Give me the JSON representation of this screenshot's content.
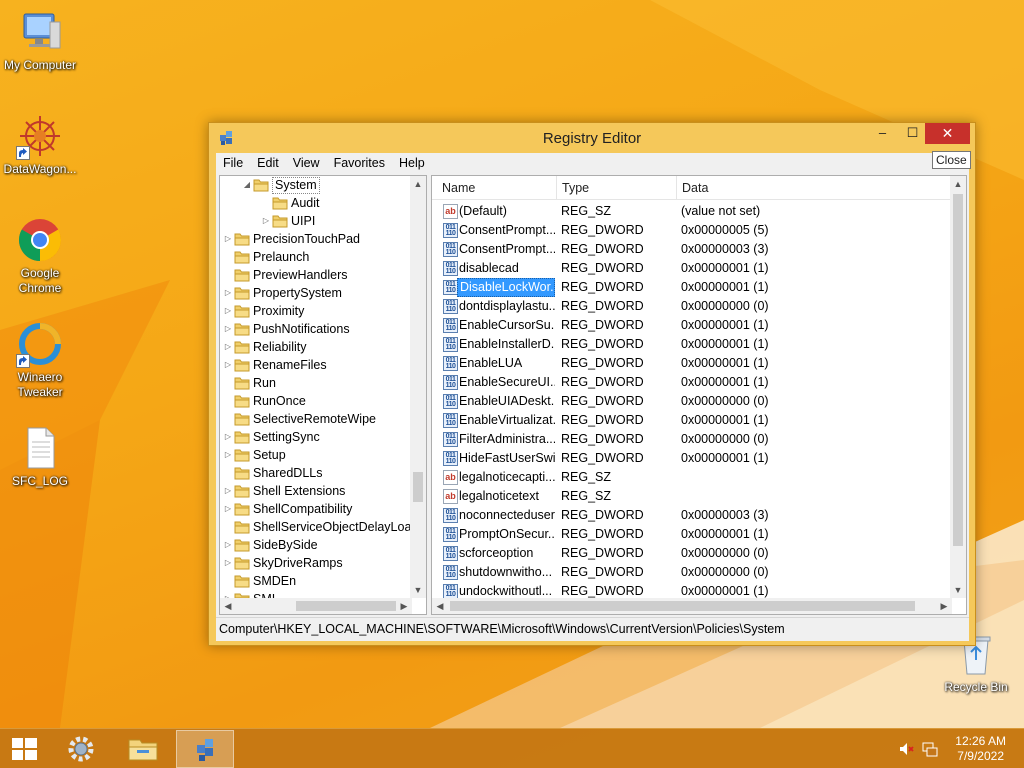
{
  "desktop": {
    "icons": [
      {
        "label": "My Computer",
        "icon": "monitor-icon"
      },
      {
        "label": "DataWagon...",
        "icon": "datawagon-icon"
      },
      {
        "label": "Google Chrome",
        "icon": "chrome-icon"
      },
      {
        "label": "Winaero Tweaker",
        "icon": "winaero-icon"
      },
      {
        "label": "SFC_LOG",
        "icon": "text-file-icon"
      },
      {
        "label": "Recycle Bin",
        "icon": "recycle-bin-icon"
      }
    ]
  },
  "window": {
    "title": "Registry Editor",
    "minimize": "–",
    "maximize": "☐",
    "close": "✕",
    "close_tooltip": "Close",
    "menu": [
      "File",
      "Edit",
      "View",
      "Favorites",
      "Help"
    ],
    "status_path": "Computer\\HKEY_LOCAL_MACHINE\\SOFTWARE\\Microsoft\\Windows\\CurrentVersion\\Policies\\System"
  },
  "tree": {
    "items": [
      {
        "label": "System",
        "expander": "◢",
        "selected": true
      },
      {
        "label": "Audit",
        "expander": ""
      },
      {
        "label": "UIPI",
        "expander": "▷"
      },
      {
        "label": "PrecisionTouchPad",
        "expander": "▷"
      },
      {
        "label": "Prelaunch",
        "expander": ""
      },
      {
        "label": "PreviewHandlers",
        "expander": ""
      },
      {
        "label": "PropertySystem",
        "expander": "▷"
      },
      {
        "label": "Proximity",
        "expander": "▷"
      },
      {
        "label": "PushNotifications",
        "expander": "▷"
      },
      {
        "label": "Reliability",
        "expander": "▷"
      },
      {
        "label": "RenameFiles",
        "expander": "▷"
      },
      {
        "label": "Run",
        "expander": ""
      },
      {
        "label": "RunOnce",
        "expander": ""
      },
      {
        "label": "SelectiveRemoteWipe",
        "expander": ""
      },
      {
        "label": "SettingSync",
        "expander": "▷"
      },
      {
        "label": "Setup",
        "expander": "▷"
      },
      {
        "label": "SharedDLLs",
        "expander": ""
      },
      {
        "label": "Shell Extensions",
        "expander": "▷"
      },
      {
        "label": "ShellCompatibility",
        "expander": "▷"
      },
      {
        "label": "ShellServiceObjectDelayLoad",
        "expander": ""
      },
      {
        "label": "SideBySide",
        "expander": "▷"
      },
      {
        "label": "SkyDriveRamps",
        "expander": "▷"
      },
      {
        "label": "SMDEn",
        "expander": ""
      },
      {
        "label": "SMI",
        "expander": "▷"
      }
    ]
  },
  "list": {
    "columns": [
      "Name",
      "Type",
      "Data"
    ],
    "rows": [
      {
        "name": "(Default)",
        "type": "REG_SZ",
        "data": "(value not set)",
        "kind": "sz"
      },
      {
        "name": "ConsentPrompt...",
        "type": "REG_DWORD",
        "data": "0x00000005 (5)",
        "kind": "dword"
      },
      {
        "name": "ConsentPrompt...",
        "type": "REG_DWORD",
        "data": "0x00000003 (3)",
        "kind": "dword"
      },
      {
        "name": "disablecad",
        "type": "REG_DWORD",
        "data": "0x00000001 (1)",
        "kind": "dword"
      },
      {
        "name": "DisableLockWor...",
        "type": "REG_DWORD",
        "data": "0x00000001 (1)",
        "kind": "dword",
        "selected": true
      },
      {
        "name": "dontdisplaylastu...",
        "type": "REG_DWORD",
        "data": "0x00000000 (0)",
        "kind": "dword"
      },
      {
        "name": "EnableCursorSu...",
        "type": "REG_DWORD",
        "data": "0x00000001 (1)",
        "kind": "dword"
      },
      {
        "name": "EnableInstallerD...",
        "type": "REG_DWORD",
        "data": "0x00000001 (1)",
        "kind": "dword"
      },
      {
        "name": "EnableLUA",
        "type": "REG_DWORD",
        "data": "0x00000001 (1)",
        "kind": "dword"
      },
      {
        "name": "EnableSecureUI...",
        "type": "REG_DWORD",
        "data": "0x00000001 (1)",
        "kind": "dword"
      },
      {
        "name": "EnableUIADeskt...",
        "type": "REG_DWORD",
        "data": "0x00000000 (0)",
        "kind": "dword"
      },
      {
        "name": "EnableVirtualizat...",
        "type": "REG_DWORD",
        "data": "0x00000001 (1)",
        "kind": "dword"
      },
      {
        "name": "FilterAdministra...",
        "type": "REG_DWORD",
        "data": "0x00000000 (0)",
        "kind": "dword"
      },
      {
        "name": "HideFastUserSwi...",
        "type": "REG_DWORD",
        "data": "0x00000001 (1)",
        "kind": "dword"
      },
      {
        "name": "legalnoticecapti...",
        "type": "REG_SZ",
        "data": "",
        "kind": "sz"
      },
      {
        "name": "legalnoticetext",
        "type": "REG_SZ",
        "data": "",
        "kind": "sz"
      },
      {
        "name": "noconnecteduser",
        "type": "REG_DWORD",
        "data": "0x00000003 (3)",
        "kind": "dword"
      },
      {
        "name": "PromptOnSecur...",
        "type": "REG_DWORD",
        "data": "0x00000001 (1)",
        "kind": "dword"
      },
      {
        "name": "scforceoption",
        "type": "REG_DWORD",
        "data": "0x00000000 (0)",
        "kind": "dword"
      },
      {
        "name": "shutdownwitho...",
        "type": "REG_DWORD",
        "data": "0x00000000 (0)",
        "kind": "dword"
      },
      {
        "name": "undockwithoutl...",
        "type": "REG_DWORD",
        "data": "0x00000001 (1)",
        "kind": "dword"
      }
    ]
  },
  "taskbar": {
    "start": "windows-logo-icon",
    "pinned": [
      "settings-gear-icon",
      "file-explorer-icon",
      "registry-editor-icon"
    ],
    "time": "12:26 AM",
    "date": "7/9/2022"
  }
}
